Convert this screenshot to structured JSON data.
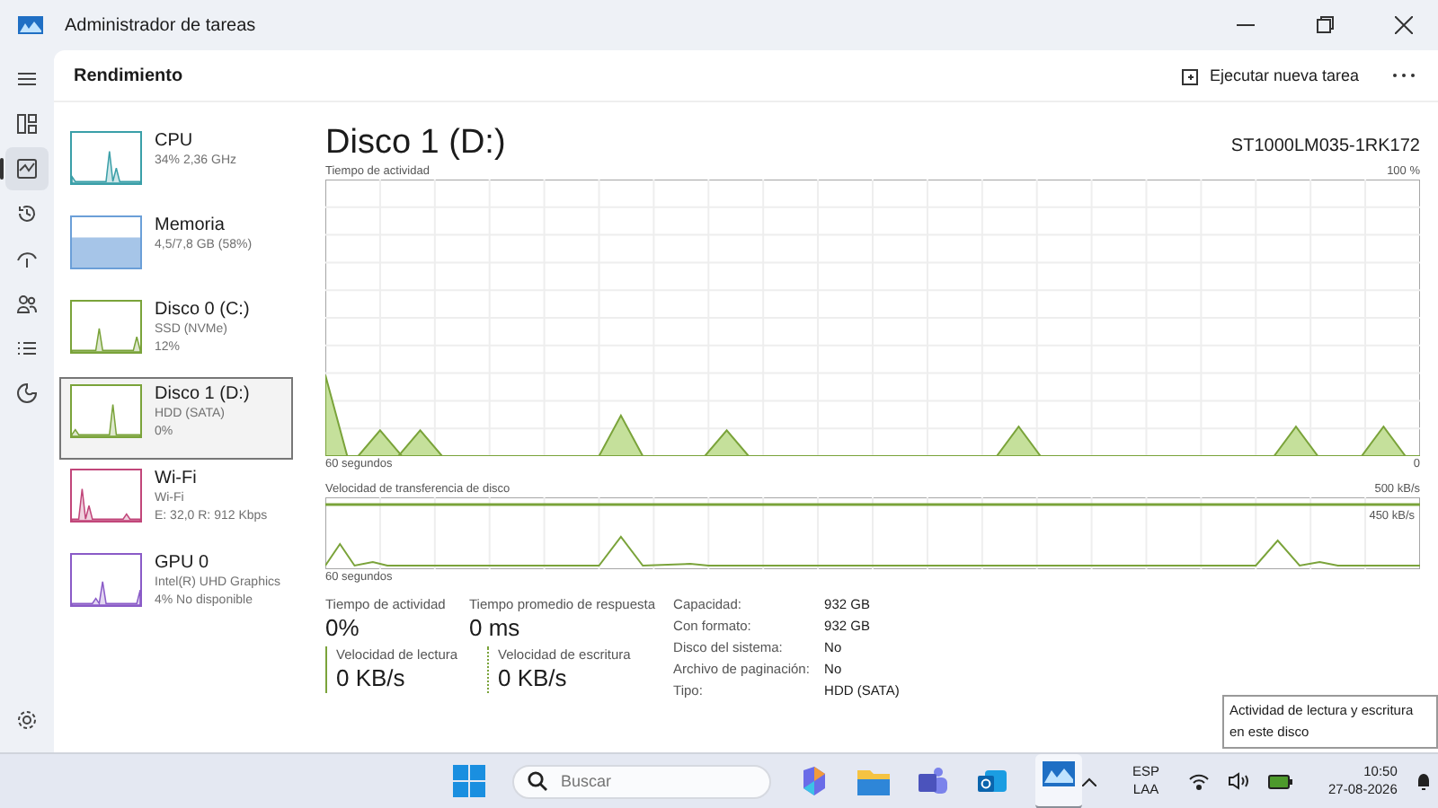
{
  "window": {
    "title": "Administrador de tareas"
  },
  "header": {
    "title": "Rendimiento",
    "action": "Ejecutar nueva tarea"
  },
  "nav": [
    {
      "kind": "menu",
      "selected": false
    },
    {
      "kind": "processes",
      "selected": false
    },
    {
      "kind": "performance",
      "selected": true
    },
    {
      "kind": "history",
      "selected": false
    },
    {
      "kind": "startup",
      "selected": false
    },
    {
      "kind": "users",
      "selected": false
    },
    {
      "kind": "details",
      "selected": false
    },
    {
      "kind": "services",
      "selected": false
    }
  ],
  "sidebar": {
    "items": [
      {
        "name": "CPU",
        "lines": [
          "34% 2,36 GHz"
        ],
        "color": "#3a9fa8",
        "selected": false
      },
      {
        "name": "Memoria",
        "lines": [
          "4,5/7,8 GB (58%)"
        ],
        "color": "#6b9fd8",
        "selected": false
      },
      {
        "name": "Disco 0 (C:)",
        "lines": [
          "SSD (NVMe)",
          "12%"
        ],
        "color": "#7aa33a",
        "selected": false
      },
      {
        "name": "Disco 1 (D:)",
        "lines": [
          "HDD (SATA)",
          "0%"
        ],
        "color": "#7aa33a",
        "selected": true
      },
      {
        "name": "Wi-Fi",
        "lines": [
          "Wi-Fi",
          "E: 32,0 R: 912 Kbps"
        ],
        "color": "#c1467a",
        "selected": false
      },
      {
        "name": "GPU 0",
        "lines": [
          "Intel(R) UHD Graphics",
          "4% No disponible"
        ],
        "color": "#8a5bc7",
        "selected": false
      }
    ]
  },
  "detail": {
    "title": "Disco 1 (D:)",
    "model": "ST1000LM035-1RK172",
    "activity": {
      "label": "Tiempo de actividad",
      "max": "100 %",
      "time": "60 segundos",
      "min": "0"
    },
    "transfer": {
      "label": "Velocidad de transferencia de disco",
      "max": "500 kB/s",
      "line": "450 kB/s",
      "time": "60 segundos"
    },
    "tooltip": "Actividad de lectura y escritura en este disco",
    "stats": [
      {
        "label": "Tiempo de actividad",
        "value": "0%"
      },
      {
        "label": "Tiempo promedio de respuesta",
        "value": "0 ms"
      }
    ],
    "speeds": [
      {
        "label": "Velocidad de lectura",
        "value": "0 KB/s",
        "kind": "solid"
      },
      {
        "label": "Velocidad de escritura",
        "value": "0 KB/s",
        "kind": "dotted"
      }
    ],
    "props": [
      {
        "label": "Capacidad:",
        "value": "932 GB"
      },
      {
        "label": "Con formato:",
        "value": "932 GB"
      },
      {
        "label": "Disco del sistema:",
        "value": "No"
      },
      {
        "label": "Archivo de paginación:",
        "value": "No"
      },
      {
        "label": "Tipo:",
        "value": "HDD (SATA)"
      }
    ]
  },
  "taskbar": {
    "search": {
      "placeholder": "Buscar"
    },
    "lang": [
      "ESP",
      "LAA"
    ],
    "time": "10:50",
    "date": "27-08-2026"
  }
}
